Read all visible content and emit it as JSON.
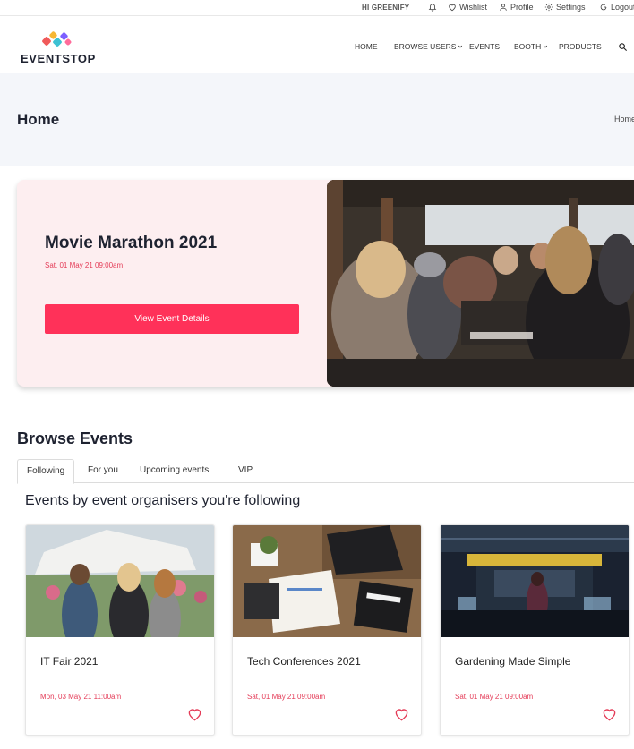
{
  "topbar": {
    "greeting": "HI GREENIFY",
    "wishlist": "Wishlist",
    "profile": "Profile",
    "settings": "Settings",
    "logout": "Logout"
  },
  "brand": {
    "name": "EVENTSTOP"
  },
  "nav": {
    "home": "HOME",
    "browse_users": "BROWSE USERS",
    "events": "EVENTS",
    "booth": "BOOTH",
    "products": "PRODUCTS"
  },
  "page": {
    "title": "Home",
    "breadcrumb": "Home"
  },
  "hero": {
    "title": "Movie Marathon 2021",
    "date": "Sat, 01 May 21 09:00am",
    "button": "View Event Details"
  },
  "browse": {
    "title": "Browse Events",
    "tabs": [
      "Following",
      "For you",
      "Upcoming events",
      "VIP"
    ],
    "section_title": "Events by event organisers you're following"
  },
  "events": [
    {
      "title": "IT Fair 2021",
      "date": "Mon, 03 May 21 11:00am"
    },
    {
      "title": "Tech Conferences 2021",
      "date": "Sat, 01 May 21 09:00am"
    },
    {
      "title": "Gardening Made Simple",
      "date": "Sat, 01 May 21 09:00am"
    }
  ],
  "colors": {
    "accent": "#ff3159",
    "date_red": "#e43b57",
    "hero_bg": "#fdeef0",
    "header_bg": "#f4f6fa"
  }
}
